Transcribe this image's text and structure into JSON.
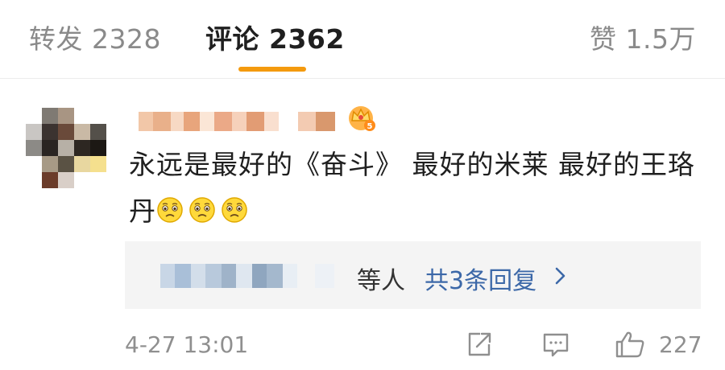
{
  "tabs": {
    "forward": "转发 2328",
    "comments": "评论 2362",
    "likes": "赞 1.5万"
  },
  "comment": {
    "text": "永远是最好的《奋斗》 最好的米莱 最好的王珞丹",
    "emoji_icon": "pleading-face-icon",
    "emoji_count": 3,
    "timestamp": "4-27 13:01",
    "like_count": "227"
  },
  "replies": {
    "suffix": "等人",
    "count_label": "共3条回复"
  },
  "colors": {
    "accent": "#f49a0e",
    "link": "#3c68a8",
    "muted": "#8f8f8f"
  }
}
